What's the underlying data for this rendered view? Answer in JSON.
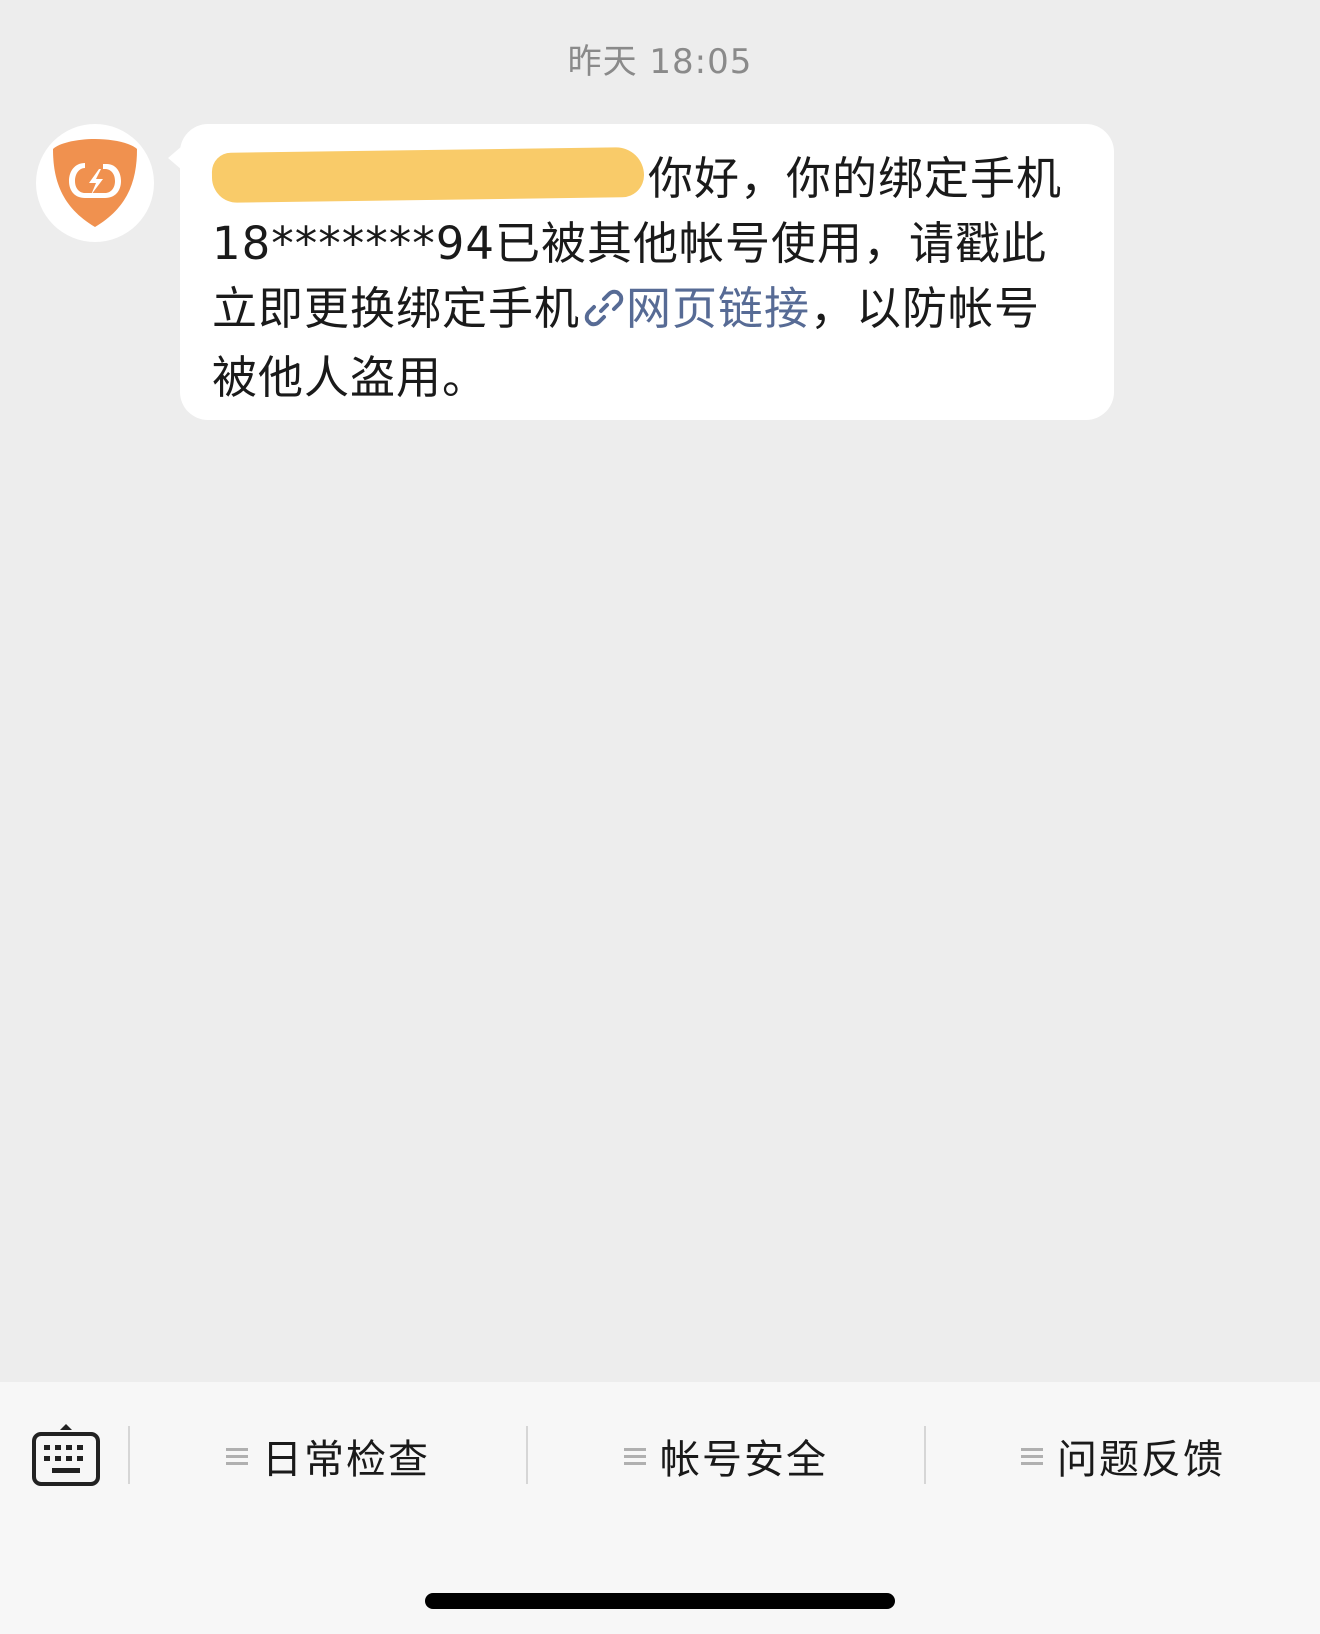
{
  "chat": {
    "timestamp": "昨天 18:05",
    "message": {
      "sender_name_redacted": true,
      "part1": "你好，你的绑定手机18*******94已被其他帐号使用，请戳此立即更换绑定手机",
      "link_text": "网页链接",
      "part2": "，以防帐号被他人盗用。"
    }
  },
  "menu": {
    "items": [
      {
        "label": "日常检查"
      },
      {
        "label": "帐号安全"
      },
      {
        "label": "问题反馈"
      }
    ]
  },
  "colors": {
    "background": "#ededed",
    "bubble": "#ffffff",
    "link": "#576b95",
    "avatar_orange": "#f0914f",
    "redaction": "#f9cb69"
  },
  "icons": {
    "avatar": "shield-lightning-icon",
    "link": "link-icon",
    "keyboard": "keyboard-icon",
    "menu": "menu-lines-icon"
  }
}
